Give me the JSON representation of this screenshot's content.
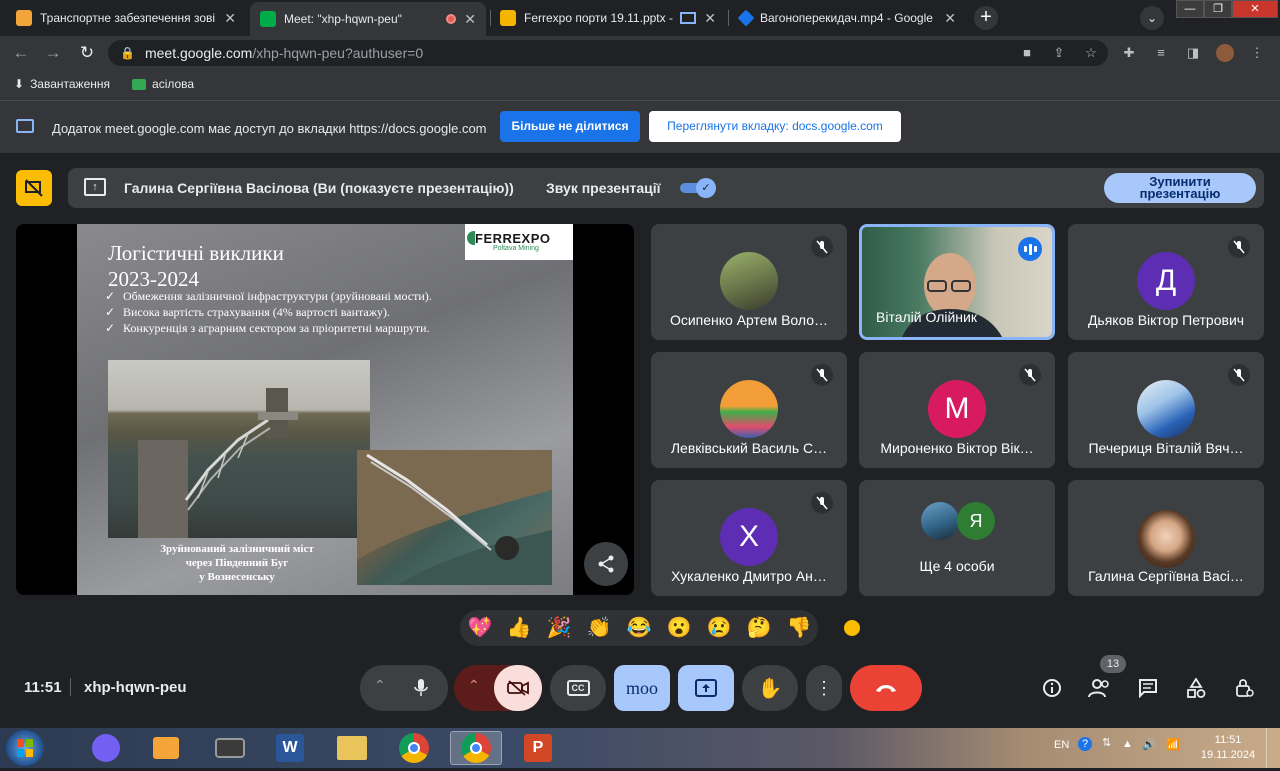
{
  "browser": {
    "tabs": [
      {
        "title": "Транспортне забезпечення зові",
        "favicon_color": "#f4a53a",
        "active": false
      },
      {
        "title": "Meet: \"xhp-hqwn-peu\"",
        "favicon_color": "#00ac47",
        "active": true,
        "recording_dot": true
      },
      {
        "title": "Ferrexpo порти 19.11.pptx -",
        "favicon_color": "#f4b400",
        "active": false
      },
      {
        "title": "Вагоноперекидач.mp4 - Google",
        "favicon_color": "#1a73e8",
        "active": false
      }
    ],
    "close_glyph": "✕",
    "new_tab_glyph": "+",
    "url_host": "meet.google.com",
    "url_path": "/xhp-hqwn-peu?authuser=0",
    "bookmarks": [
      {
        "label": "Завантаження",
        "icon": "download-icon"
      },
      {
        "label": "асілова",
        "icon": "folder-icon"
      }
    ],
    "infobar": {
      "message": "Додаток meet.google.com має доступ до вкладки https://docs.google.com",
      "stop_sharing": "Більше не ділитися",
      "view_tab": "Переглянути вкладку: docs.google.com"
    }
  },
  "presenting_bar": {
    "presenter": "Галина Сергіївна Васілова (Ви (показуєте презентацію))",
    "audio_label": "Звук презентації",
    "audio_enabled": true,
    "stop_line1": "Зупинити",
    "stop_line2": "презентацію",
    "accent": "#fbbc04"
  },
  "slide": {
    "title_line1": "Логістичні виклики",
    "title_line2": "2023-2024",
    "logo_text": "FERREXPO",
    "logo_sub": "Poltava Mining",
    "bullet_glyph": "✓",
    "bullets": [
      "Обмеження залізничної інфраструктури (зруйновані мости).",
      "Висока вартість страхування (4% вартості вантажу).",
      "Конкуренція з аграрним сектором за пріоритетні маршрути."
    ],
    "caption_line1": "Зруйнований залізничний міст",
    "caption_line2": "через Південний Буг",
    "caption_line3": "у Вознесенську"
  },
  "participants": [
    {
      "name": "Осипенко Артем Воло…",
      "avatar": "photo",
      "color": "#6b7a4c",
      "muted": true
    },
    {
      "name": "Віталій Олійник",
      "avatar": "video",
      "color": "#2f5d48",
      "muted": false,
      "speaking": true
    },
    {
      "name": "Дьяков Віктор Петрович",
      "avatar": "Д",
      "color": "#5d2db3",
      "muted": true
    },
    {
      "name": "Левківський Василь С…",
      "avatar": "photo",
      "color": "#f29d38",
      "muted": true
    },
    {
      "name": "Мироненко Віктор Вік…",
      "avatar": "М",
      "color": "#d81b60",
      "muted": true
    },
    {
      "name": "Печериця Віталій Вяч…",
      "avatar": "photo",
      "color": "#9fc4e8",
      "muted": true
    },
    {
      "name": "Хукаленко Дмитро Ан…",
      "avatar": "Х",
      "color": "#5d2db3",
      "muted": true
    },
    {
      "name": "Ще 4 особи",
      "avatar": "group",
      "color": "#2e7d32",
      "letter": "Я",
      "muted": false
    },
    {
      "name": "Галина Сергіївна Васі…",
      "avatar": "photo",
      "color": "#7a5a44",
      "muted": false
    }
  ],
  "reactions": [
    "💖",
    "👍",
    "🎉",
    "👏",
    "😂",
    "😮",
    "😢",
    "🤔",
    "👎"
  ],
  "controls": {
    "time": "11:51",
    "meeting_code": "xhp-hqwn-peu",
    "captions_label": "CC",
    "moo_label": "moo",
    "participants_count": "13"
  },
  "taskbar": {
    "lang": "EN",
    "time": "11:51",
    "date": "19.11.2024"
  }
}
